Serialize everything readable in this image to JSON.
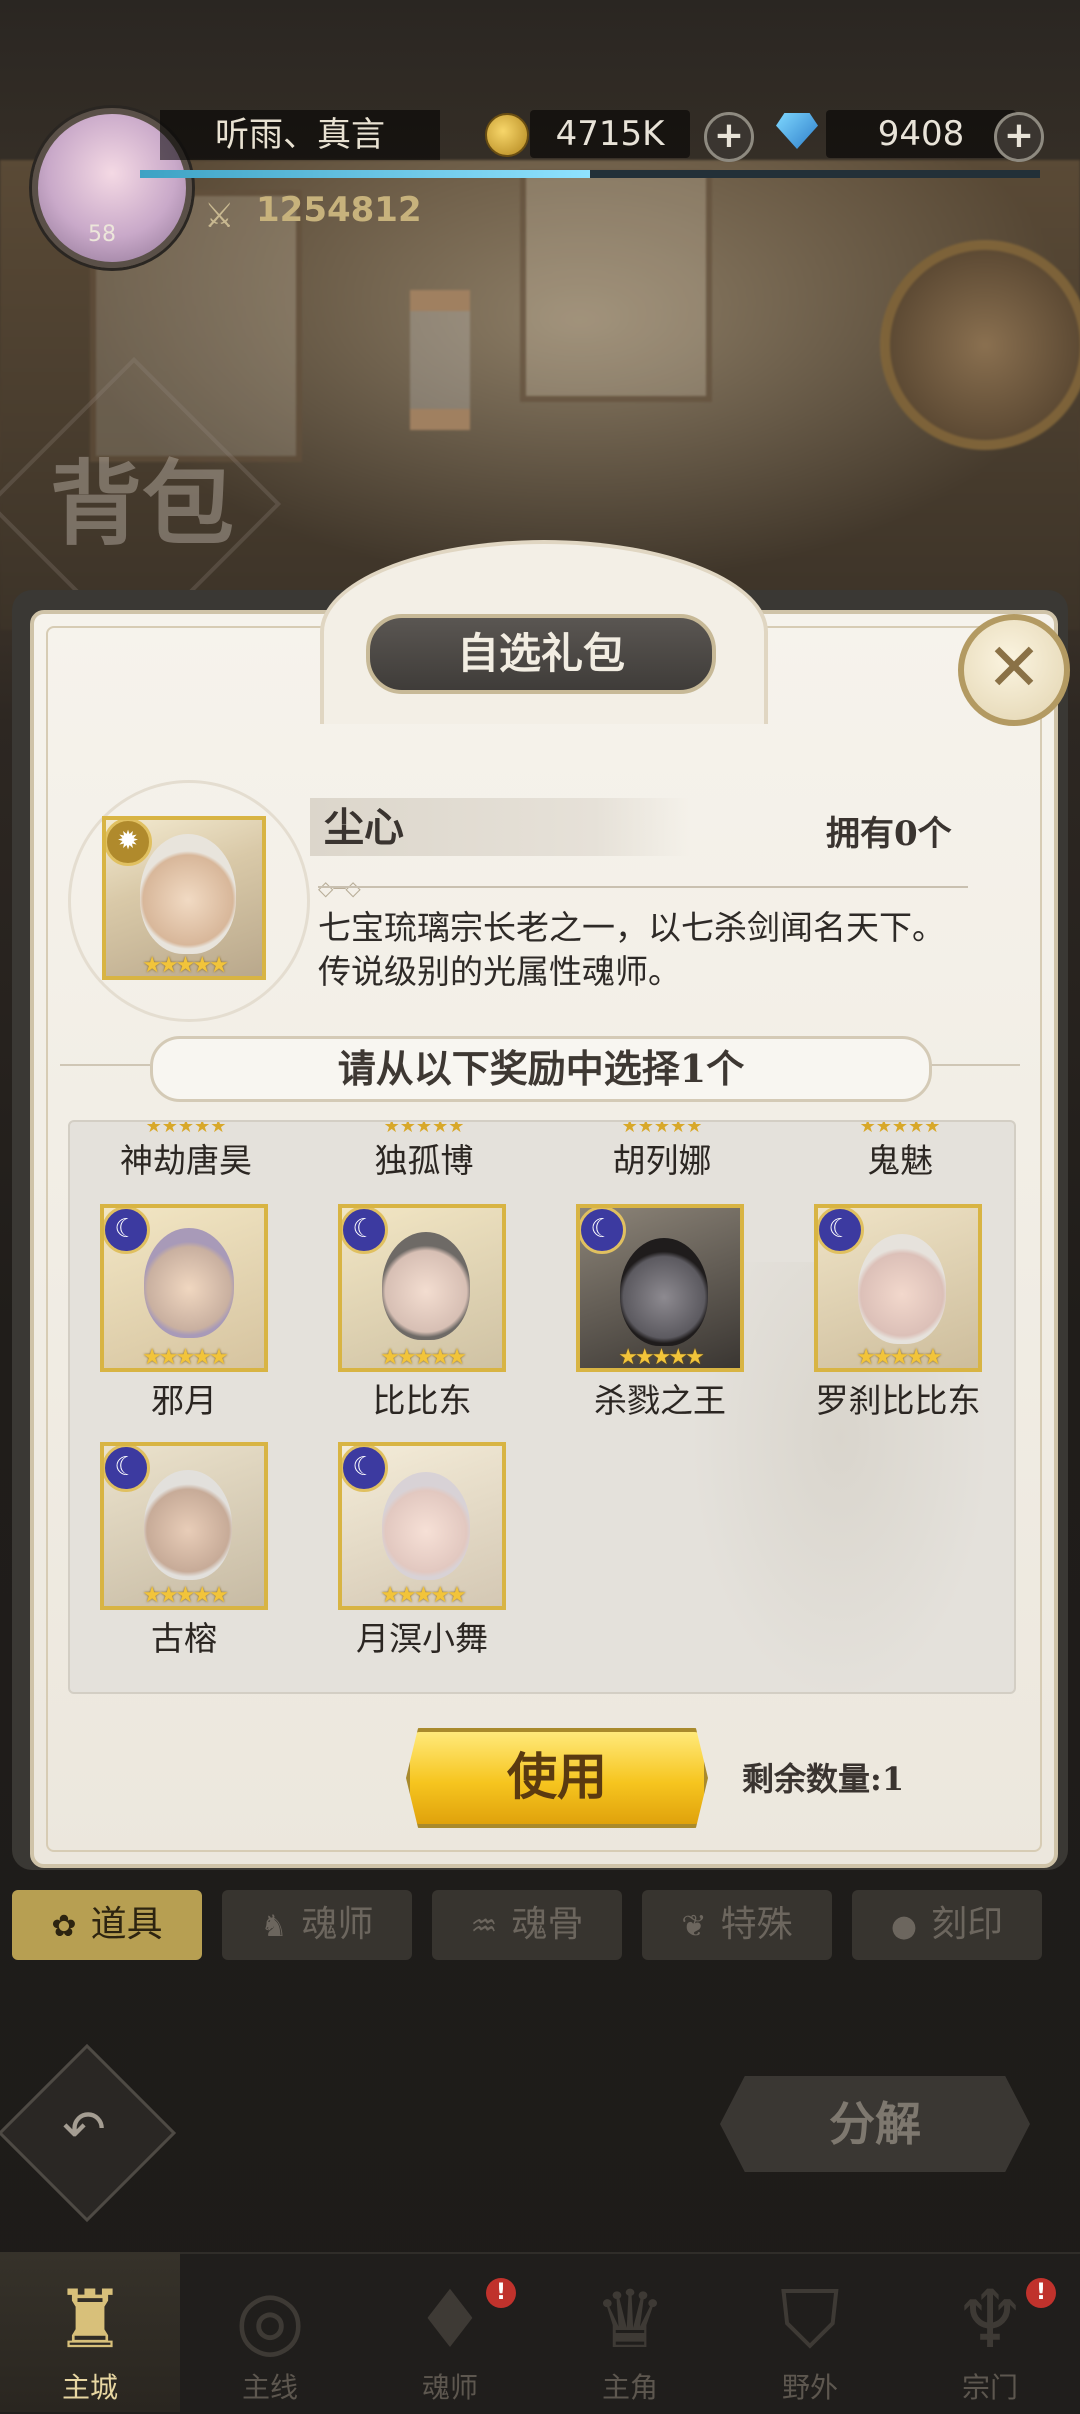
{
  "header": {
    "player_name": "听雨、真言",
    "level": "58",
    "power": "1254812",
    "exp_fraction": 0.5,
    "gold": "4715K",
    "diamonds": "9408",
    "plus_symbol": "+"
  },
  "page_title": "背包",
  "dialog": {
    "title": "自选礼包",
    "close_symbol": "✕",
    "featured": {
      "name": "尘心",
      "owned": "拥有0个",
      "stars": "★★★★★",
      "description": "七宝琉璃宗长老之一，以七杀剑闻名天下。传说级别的光属性魂师。"
    },
    "choose_prompt": "请从以下奖励中选择1个",
    "top_row_names": [
      "神劫唐昊",
      "独孤博",
      "胡列娜",
      "鬼魅"
    ],
    "heroes": [
      {
        "name": "邪月",
        "stars": "★★★★★"
      },
      {
        "name": "比比东",
        "stars": "★★★★★"
      },
      {
        "name": "杀戮之王",
        "stars": "★★★★★"
      },
      {
        "name": "罗刹比比东",
        "stars": "★★★★★"
      },
      {
        "name": "古榕",
        "stars": "★★★★★"
      },
      {
        "name": "月溟小舞",
        "stars": "★★★★★"
      }
    ],
    "use_button": "使用",
    "remaining": "剩余数量:1"
  },
  "tabs": [
    {
      "label": "道具",
      "icon": "✿",
      "active": true
    },
    {
      "label": "魂师",
      "icon": "♞",
      "active": false
    },
    {
      "label": "魂骨",
      "icon": "♒",
      "active": false
    },
    {
      "label": "特殊",
      "icon": "❦",
      "active": false
    },
    {
      "label": "刻印",
      "icon": "●",
      "active": false
    }
  ],
  "back_icon": "↶",
  "decompose_button": "分解",
  "nav": [
    {
      "label": "主城",
      "glyph": "♜",
      "badge": ""
    },
    {
      "label": "主线",
      "glyph": "◎",
      "badge": ""
    },
    {
      "label": "魂师",
      "glyph": "♦",
      "badge": "!"
    },
    {
      "label": "主角",
      "glyph": "♛",
      "badge": ""
    },
    {
      "label": "野外",
      "glyph": "⛉",
      "badge": ""
    },
    {
      "label": "宗门",
      "glyph": "♆",
      "badge": "!"
    }
  ],
  "colors": {
    "gold_accent": "#d8b443",
    "use_button": "#f6c51f",
    "active_tab": "#b79f52",
    "badge_red": "#c0322c"
  }
}
